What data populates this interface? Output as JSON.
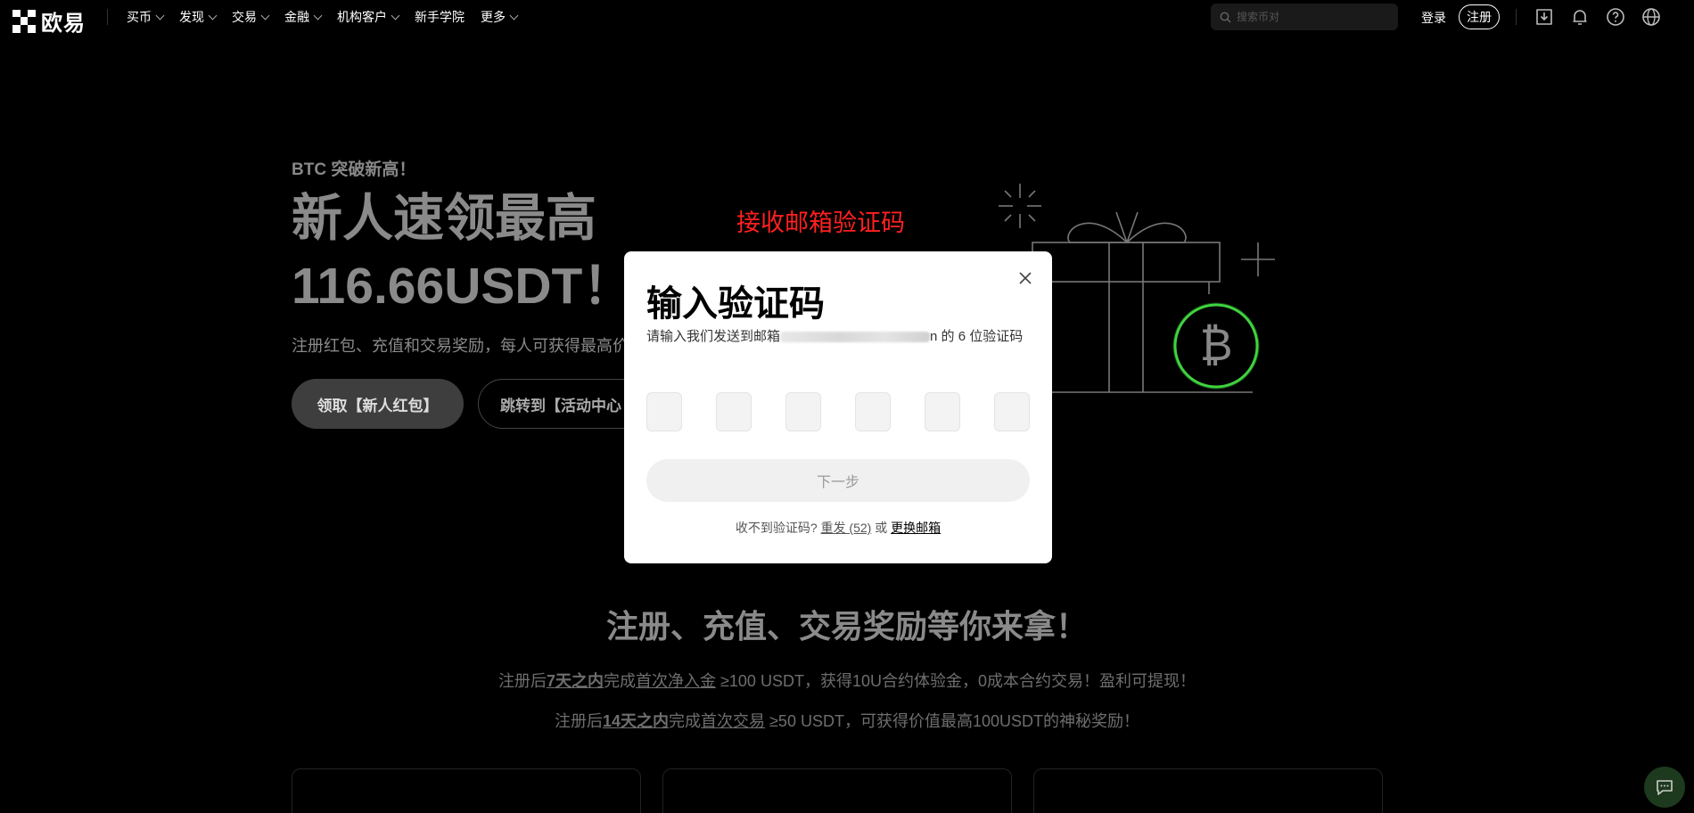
{
  "nav": {
    "logo_text": "欧易",
    "menu": [
      {
        "label": "买币",
        "has_dropdown": true
      },
      {
        "label": "发现",
        "has_dropdown": true
      },
      {
        "label": "交易",
        "has_dropdown": true
      },
      {
        "label": "金融",
        "has_dropdown": true
      },
      {
        "label": "机构客户",
        "has_dropdown": true
      },
      {
        "label": "新手学院",
        "has_dropdown": false
      },
      {
        "label": "更多",
        "has_dropdown": true
      }
    ],
    "search_placeholder": "搜索币对",
    "login_label": "登录",
    "register_label": "注册",
    "icons": [
      "download-icon",
      "bell-icon",
      "help-icon",
      "globe-icon"
    ]
  },
  "hero": {
    "tag": "BTC 突破新高！",
    "title_line1": "新人速领最高",
    "title_line2": "116.66USDT！",
    "subtitle": "注册红包、充值和交易奖励，每人可获得最高价",
    "primary_button": "领取【新人红包】",
    "secondary_button": "跳转到【活动中心"
  },
  "annotation": {
    "text": "接收邮箱验证码",
    "color": "#ff2020"
  },
  "section": {
    "title": "注册、充值、交易奖励等你来拿！",
    "line1": {
      "p1": "注册后",
      "b1": "7天之内",
      "p2": "完成",
      "u1": "首次净入金",
      "p3": " ≥100 USDT，获得10U合约体验金，0成本合约交易！盈利可提现！"
    },
    "line2": {
      "p1": "注册后",
      "b1": "14天之内",
      "p2": "完成",
      "u1": "首次交易",
      "p3": " ≥50 USDT，可获得价值最高100USDT的神秘奖励！"
    }
  },
  "modal": {
    "title": "输入验证码",
    "desc_prefix": "请输入我们发送到邮箱",
    "desc_suffix": "n 的 6 位验证码",
    "code_length": 6,
    "next_button": "下一步",
    "resend_prompt": "收不到验证码?",
    "resend_link": "重发 (52)",
    "or_text": "或",
    "change_email_link": "更换邮箱"
  },
  "colors": {
    "background": "#000000",
    "bitcoin_ring": "#3fd43f",
    "modal_bg": "#ffffff"
  }
}
